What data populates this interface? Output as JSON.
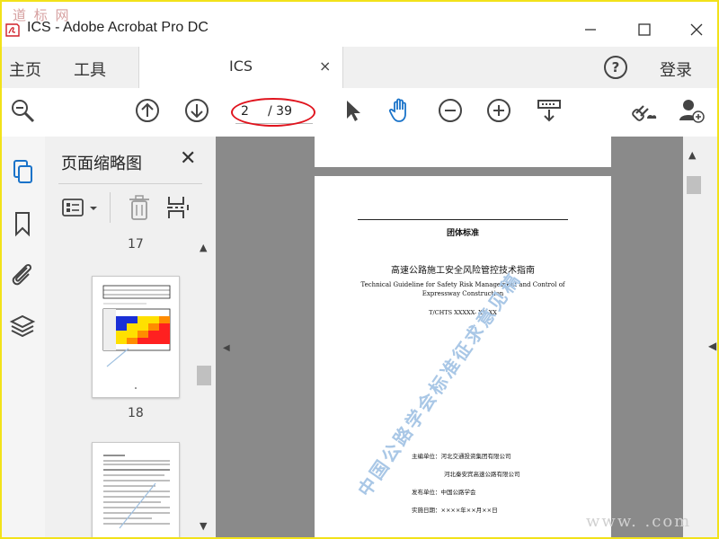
{
  "window": {
    "title": "ICS - Adobe Acrobat Pro DC",
    "watermark_top": "道 标 网",
    "watermark_bottom": "www.     .com"
  },
  "menu": {
    "home": "主页",
    "tools": "工具",
    "tab_label": "ICS",
    "tab_close": "×",
    "help": "?",
    "login": "登录"
  },
  "toolbar": {
    "page_current": "2",
    "page_total": "/ 39"
  },
  "thumbnails": {
    "title": "页面缩略图",
    "close": "✕",
    "page_a": "17",
    "page_b": "18"
  },
  "document": {
    "std_type": "团体标准",
    "title_cn": "高速公路施工安全风险管控技术指南",
    "title_en_1": "Technical Guideline for Safety Risk Management and Control of",
    "title_en_2": "Expressway Construction",
    "code": "T/CHTS XXXXX- XX XX",
    "editor_label": "主编单位：河北交通投资集团有限公司",
    "editor_2": "河北秦安宾高速公路有限公司",
    "publisher": "发布单位：中国公路学会",
    "date": "实施日期：××××年××月××日",
    "watermark": "中国公路学会标准征求意见稿"
  },
  "colors": {
    "accent_blue": "#1a73c9",
    "highlight_red": "#e0141e",
    "doc_bg": "#8a8a8a"
  }
}
